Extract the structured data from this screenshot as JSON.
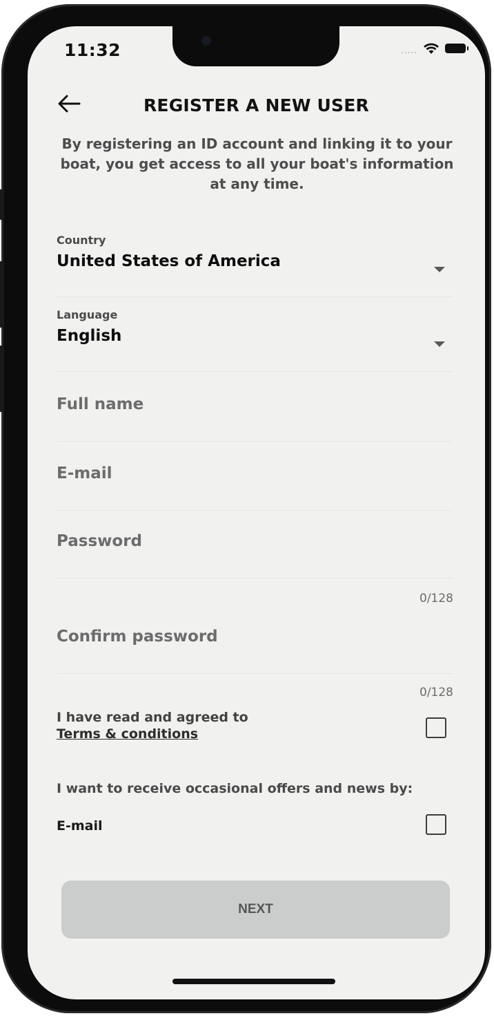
{
  "status_bar": {
    "time": "11:32",
    "signal_dots": "....."
  },
  "header": {
    "title": "REGISTER A NEW USER"
  },
  "intro": "By registering an ID account and linking it to your boat, you get access to all your boat's information at any time.",
  "form": {
    "country": {
      "label": "Country",
      "value": "United States of America"
    },
    "language": {
      "label": "Language",
      "value": "English"
    },
    "full_name": {
      "placeholder": "Full name"
    },
    "email": {
      "placeholder": "E-mail"
    },
    "password": {
      "placeholder": "Password",
      "counter": "0/128"
    },
    "confirm_password": {
      "placeholder": "Confirm password",
      "counter": "0/128"
    }
  },
  "terms": {
    "text": "I have read and agreed to",
    "link": "Terms & conditions",
    "checked": false
  },
  "offers": {
    "label": "I want to receive occasional offers and news by:",
    "email_option": "E-mail",
    "checked": false
  },
  "actions": {
    "next_label": "NEXT"
  },
  "colors": {
    "screen_bg": "#f1f1f0",
    "button_disabled": "#cbcdcd",
    "frame": "#0c0c0c"
  }
}
